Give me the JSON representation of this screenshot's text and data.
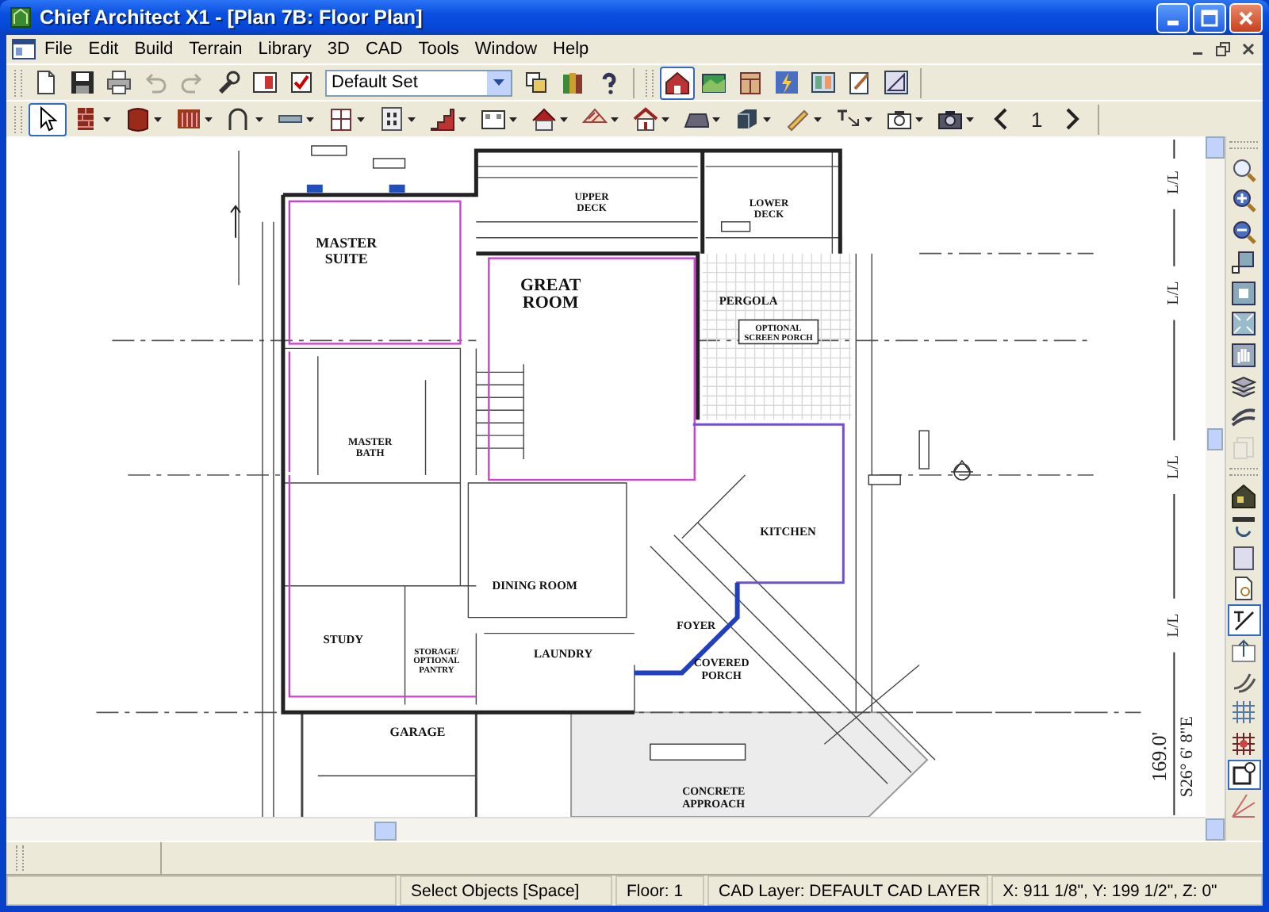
{
  "window": {
    "title": "Chief Architect X1 - [Plan 7B: Floor Plan]"
  },
  "menu_bar": {
    "items": [
      "File",
      "Edit",
      "Build",
      "Terrain",
      "Library",
      "3D",
      "CAD",
      "Tools",
      "Window",
      "Help"
    ]
  },
  "standard_toolbar": {
    "tools": [
      {
        "disabled": false
      },
      {
        "disabled": false
      },
      {
        "disabled": false
      },
      {
        "disabled": true
      },
      {
        "disabled": true
      },
      {
        "disabled": false
      },
      {
        "disabled": false
      },
      {
        "disabled": false
      }
    ],
    "layer_set": "Default Set",
    "extra_tools": [
      {
        "disabled": false
      },
      {
        "disabled": false
      },
      {
        "disabled": false
      }
    ],
    "view_tools": [
      {
        "selected": true
      },
      {
        "selected": false
      },
      {
        "selected": false
      },
      {
        "selected": false
      },
      {
        "selected": false
      },
      {
        "selected": false
      },
      {
        "selected": false
      }
    ]
  },
  "build_toolbar": {
    "tools": [
      {
        "selected": true
      },
      {
        "selected": false
      },
      {
        "selected": false
      },
      {
        "selected": false
      },
      {
        "selected": false
      },
      {
        "selected": false
      },
      {
        "selected": false
      },
      {
        "selected": false
      },
      {
        "selected": false
      },
      {
        "selected": false
      },
      {
        "selected": false
      },
      {
        "selected": false
      },
      {
        "selected": false
      },
      {
        "selected": false
      },
      {
        "selected": false
      },
      {
        "selected": false
      },
      {
        "selected": false
      },
      {
        "selected": false
      },
      {
        "selected": false
      }
    ],
    "page": "1"
  },
  "floor_plan": {
    "room_labels": [
      {
        "lines": [
          "MASTER",
          "SUITE"
        ]
      },
      {
        "lines": [
          "GREAT",
          "ROOM"
        ]
      },
      {
        "lines": [
          "UPPER",
          "DECK"
        ]
      },
      {
        "lines": [
          "LOWER",
          "DECK"
        ]
      },
      {
        "lines": [
          "PERGOLA"
        ]
      },
      {
        "lines": [
          "OPTIONAL",
          "SCREEN PORCH"
        ]
      },
      {
        "lines": [
          "MASTER",
          "BATH"
        ]
      },
      {
        "lines": [
          "KITCHEN"
        ]
      },
      {
        "lines": [
          "DINING ROOM"
        ]
      },
      {
        "lines": [
          "STUDY"
        ]
      },
      {
        "lines": [
          "STORAGE/",
          "OPTIONAL",
          "PANTRY"
        ]
      },
      {
        "lines": [
          "LAUNDRY"
        ]
      },
      {
        "lines": [
          "FOYER"
        ]
      },
      {
        "lines": [
          "COVERED",
          "PORCH"
        ]
      },
      {
        "lines": [
          "GARAGE"
        ]
      },
      {
        "lines": [
          "CONCRETE",
          "APPROACH"
        ]
      }
    ],
    "lot_line_labels": [
      "L/L",
      "L/L",
      "L/L",
      "L/L"
    ],
    "boundary": {
      "distance": "169.0'",
      "bearing": "S26° 6' 8\"E"
    }
  },
  "side_toolbar": {
    "tools": [
      {
        "selected": false,
        "disabled": false
      },
      {
        "selected": false,
        "disabled": false
      },
      {
        "selected": false,
        "disabled": false
      },
      {
        "selected": false,
        "disabled": false
      },
      {
        "selected": false,
        "disabled": false
      },
      {
        "selected": false,
        "disabled": false
      },
      {
        "selected": false,
        "disabled": false
      },
      {
        "selected": false,
        "disabled": false
      },
      {
        "selected": false,
        "disabled": false
      },
      {
        "selected": false,
        "disabled": true
      },
      {
        "selected": false,
        "disabled": false
      },
      {
        "selected": false,
        "disabled": false
      },
      {
        "selected": false,
        "disabled": false
      },
      {
        "selected": false,
        "disabled": false
      },
      {
        "selected": true,
        "disabled": false
      },
      {
        "selected": false,
        "disabled": false
      },
      {
        "selected": false,
        "disabled": false
      },
      {
        "selected": false,
        "disabled": false
      },
      {
        "selected": false,
        "disabled": false
      },
      {
        "selected": true,
        "disabled": false
      },
      {
        "selected": false,
        "disabled": false
      }
    ]
  },
  "status_bar": {
    "hint": "Select Objects [Space]",
    "floor": "Floor: 1",
    "cad_layer": "CAD Layer:  DEFAULT CAD LAYER",
    "coordinates": "X: 911 1/8\", Y: 199 1/2\", Z: 0\""
  }
}
